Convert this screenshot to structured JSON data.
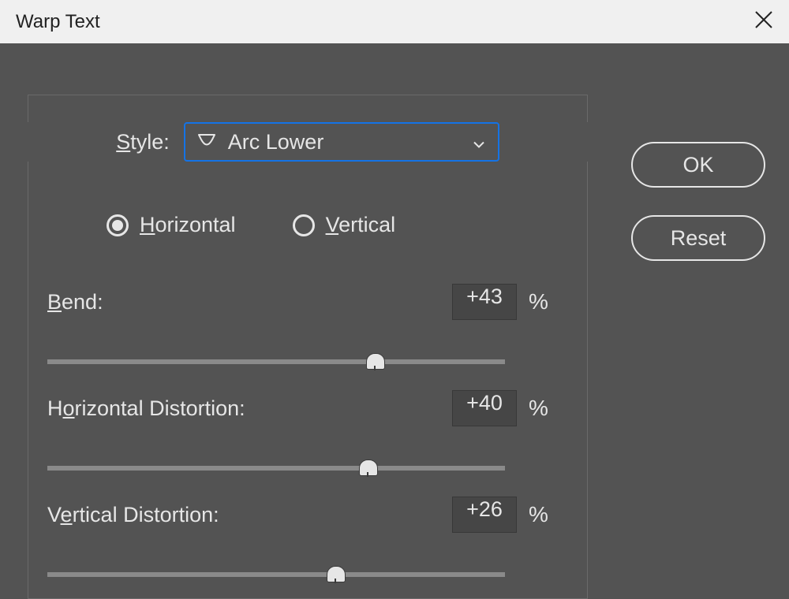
{
  "titlebar": {
    "title": "Warp Text"
  },
  "style": {
    "label_prefix": "S",
    "label_rest": "tyle:",
    "selected": "Arc Lower"
  },
  "orientation": {
    "horizontal_prefix": "H",
    "horizontal_rest": "orizontal",
    "vertical_prefix": "V",
    "vertical_rest": "ertical",
    "selected": "horizontal"
  },
  "params": {
    "bend": {
      "label_prefix": "B",
      "label_rest": "end:",
      "value": "+43",
      "unit": "%",
      "slider_pct": 71.5
    },
    "hdist": {
      "label_before": "H",
      "label_ul": "o",
      "label_after": "rizontal Distortion:",
      "value": "+40",
      "unit": "%",
      "slider_pct": 70
    },
    "vdist": {
      "label_before": "V",
      "label_ul": "e",
      "label_after": "rtical Distortion:",
      "value": "+26",
      "unit": "%",
      "slider_pct": 63
    }
  },
  "buttons": {
    "ok": "OK",
    "reset": "Reset"
  }
}
